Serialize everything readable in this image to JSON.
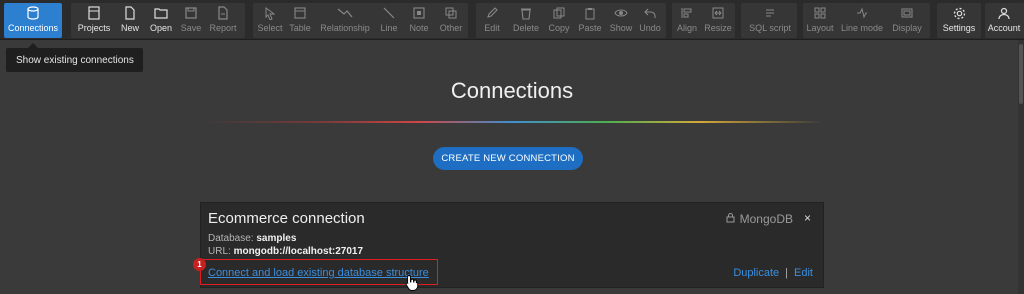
{
  "toolbar": {
    "connections": "Connections",
    "projects": "Projects",
    "new": "New",
    "open": "Open",
    "save": "Save",
    "report": "Report",
    "select": "Select",
    "table": "Table",
    "relationship": "Relationship",
    "line": "Line",
    "note": "Note",
    "other": "Other",
    "edit": "Edit",
    "delete": "Delete",
    "copy": "Copy",
    "paste": "Paste",
    "show": "Show",
    "undo": "Undo",
    "align": "Align",
    "resize": "Resize",
    "sql_script": "SQL script",
    "layout": "Layout",
    "line_mode": "Line mode",
    "display": "Display",
    "settings": "Settings",
    "account": "Account"
  },
  "tooltip": "Show existing connections",
  "main": {
    "title": "Connections",
    "create_button": "CREATE NEW CONNECTION"
  },
  "card": {
    "name": "Ecommerce connection",
    "type": "MongoDB",
    "close": "×",
    "database_label": "Database:",
    "database_value": "samples",
    "url_label": "URL:",
    "url_value": "mongodb://localhost:27017",
    "connect_link": "Connect and load existing database structure",
    "duplicate": "Duplicate",
    "separator": "|",
    "edit": "Edit"
  },
  "annotation": {
    "badge": "1"
  },
  "colors": {
    "accent": "#2d7fd0",
    "link": "#3a8fe0",
    "highlight": "#e02020"
  }
}
